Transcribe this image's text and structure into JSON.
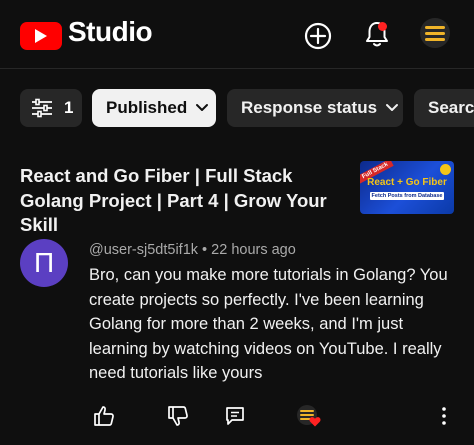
{
  "header": {
    "brand": "Studio",
    "icons": [
      "youtube-logo-icon",
      "create-icon",
      "notifications-bell-icon",
      "menu-avatar-icon"
    ]
  },
  "filters": {
    "filter_count": "1",
    "published_label": "Published",
    "response_status_label": "Response status",
    "search_label": "Search"
  },
  "video": {
    "title": "React and Go Fiber | Full Stack Golang Project | Part 4 | Grow Your Skill",
    "thumbnail": {
      "ribbon": "Full Stack",
      "headline": "React + Go Fiber",
      "subline": "Fetch Posts from Database"
    }
  },
  "comment": {
    "avatar_letter": "П",
    "author": "@user-sj5dt5if1k",
    "time": "22 hours ago",
    "text": "Bro, can you make more tutorials in Golang? You create projects so perfectly. I've been learning Golang for more than 2 weeks, and I'm just learning by watching videos on YouTube. I really need tutorials like yours"
  },
  "colors": {
    "background": "#0f0f0f",
    "brand_red": "#ff0000",
    "chip_active": "#f1f1f1",
    "chip": "#272727",
    "avatar": "#5b3fc2",
    "heart": "#ff2222"
  }
}
